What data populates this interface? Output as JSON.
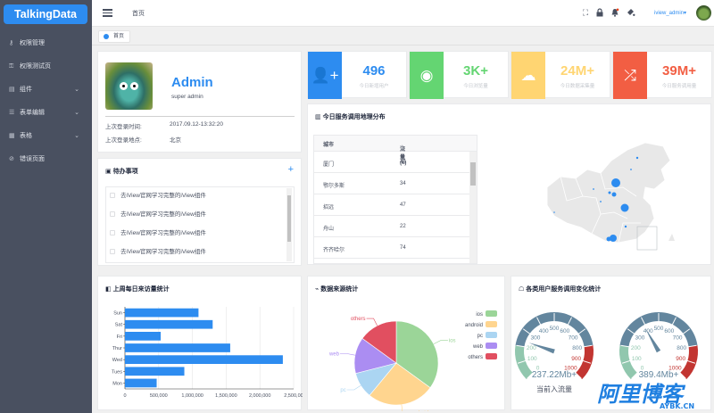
{
  "sidebar": {
    "logo": "TalkingData",
    "items": [
      {
        "label": "权限管理",
        "icon": "lock-icon",
        "glyph": "⚷",
        "has_children": false
      },
      {
        "label": "权限测试页",
        "icon": "lock-icon",
        "glyph": "⚿",
        "has_children": false
      },
      {
        "label": "组件",
        "icon": "stack-icon",
        "glyph": "▤",
        "has_children": true
      },
      {
        "label": "表单编辑",
        "icon": "edit-icon",
        "glyph": "☰",
        "has_children": true
      },
      {
        "label": "表格",
        "icon": "grid-icon",
        "glyph": "▦",
        "has_children": true
      },
      {
        "label": "错误页面",
        "icon": "error-icon",
        "glyph": "⊘",
        "has_children": false
      }
    ]
  },
  "header": {
    "breadcrumb": "首页",
    "username": "iview_admin",
    "user_caret": "▾"
  },
  "tags": [
    {
      "label": "首页",
      "active": true
    }
  ],
  "user_card": {
    "name": "Admin",
    "role": "super admin",
    "last_login_time_label": "上次登录时间:",
    "last_login_time": "2017.09.12-13:32:20",
    "last_login_place_label": "上次登录地点:",
    "last_login_place": "北京"
  },
  "todo": {
    "title": "待办事项",
    "add": "+",
    "items": [
      "去iView官网学习完整的iView组件",
      "去iView官网学习完整的iView组件",
      "去iView官网学习完整的iView组件",
      "去iView官网学习完整的iView组件"
    ]
  },
  "stats": [
    {
      "value": "496",
      "label": "今日新增用户",
      "color": "#2d8cf0",
      "icon": "user-add-icon",
      "glyph": "👤+"
    },
    {
      "value": "3K+",
      "label": "今日浏览量",
      "color": "#64d572",
      "icon": "eye-icon",
      "glyph": "◉"
    },
    {
      "value": "24M+",
      "label": "今日数据采集量",
      "color": "#ffd572",
      "icon": "cloud-upload-icon",
      "glyph": "☁"
    },
    {
      "value": "39M+",
      "label": "今日服务调用量",
      "color": "#f25e43",
      "icon": "shuffle-icon",
      "glyph": "⤮"
    }
  ],
  "geo": {
    "title": "今日服务调用地理分布",
    "col_city": "城市",
    "col_flow": "流量(k)",
    "sort_icon": "⇕",
    "rows": [
      {
        "city": "厦门",
        "flow": "45"
      },
      {
        "city": "鄂尔多斯",
        "flow": "34"
      },
      {
        "city": "招远",
        "flow": "47"
      },
      {
        "city": "舟山",
        "flow": "22"
      },
      {
        "city": "齐齐哈尔",
        "flow": "74"
      }
    ]
  },
  "week_card": {
    "title": "上周每日来访量统计"
  },
  "source_card": {
    "title": "数据来源统计"
  },
  "service_card": {
    "title": "各类用户服务调用变化统计"
  },
  "chart_data": [
    {
      "type": "bar",
      "orientation": "horizontal",
      "title": "上周每日来访量统计",
      "categories": [
        "Mon",
        "Tues",
        "Wed",
        "Thur",
        "Fri",
        "Sat",
        "Sun"
      ],
      "values": [
        470000,
        880000,
        2340000,
        1560000,
        530000,
        1300000,
        1090000
      ],
      "xlim": [
        0,
        2500000
      ],
      "xticks": [
        "0",
        "500,000",
        "1,000,000",
        "1,500,000",
        "2,000,000",
        "2,500,00"
      ],
      "grid": true,
      "color": "#2d8cf0"
    },
    {
      "type": "pie",
      "title": "数据来源统计",
      "categories": [
        "ios",
        "android",
        "pc",
        "web",
        "others"
      ],
      "values": [
        35,
        26,
        10,
        14,
        15
      ],
      "colors": [
        "#9bd598",
        "#ffd58f",
        "#abd5f2",
        "#ab8df2",
        "#e14f60"
      ],
      "legend": "right"
    },
    {
      "type": "gauge",
      "title": "各类用户服务调用变化统计",
      "gauges": [
        {
          "value": 237.22,
          "label": "237.22Mb+",
          "max": 1000,
          "ticks": [
            "0",
            "100",
            "200",
            "300",
            "400",
            "500",
            "600",
            "700",
            "800",
            "900",
            "1000"
          ],
          "caption": "当前入流量"
        },
        {
          "value": 389.4,
          "label": "389.4Mb+",
          "max": 1000,
          "ticks": [
            "0",
            "100",
            "200",
            "300",
            "400",
            "500",
            "600",
            "700",
            "800",
            "900",
            "1000"
          ],
          "caption": ""
        }
      ],
      "band_colors": [
        "#91c7ae",
        "#63869e",
        "#c23531"
      ]
    }
  ],
  "watermark": {
    "text": "阿里博客",
    "sub": "AYBK.CN"
  },
  "colors": {
    "primary": "#2d8cf0",
    "sidebar": "#495060"
  }
}
